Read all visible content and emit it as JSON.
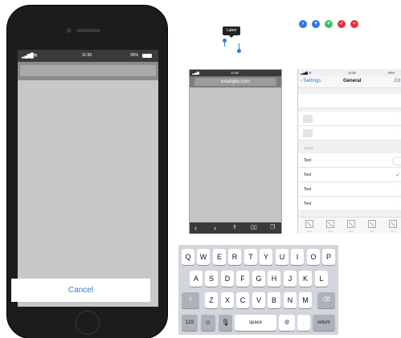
{
  "phone": {
    "status": {
      "time": "11:56",
      "battery": "95%"
    },
    "cancel_label": "Cancel"
  },
  "tooltip": {
    "label": "Label"
  },
  "icons": [
    "arrow-right-circle-icon",
    "plus-circle-icon",
    "add-circle-icon",
    "check-circle-icon",
    "minus-circle-icon"
  ],
  "browser": {
    "status": {
      "time": "11:56"
    },
    "url": "example.com",
    "toolbar": [
      "back-icon",
      "forward-icon",
      "share-icon",
      "bookmarks-icon",
      "tabs-icon"
    ]
  },
  "settings": {
    "status": {
      "time": "11:56",
      "battery": "96%"
    },
    "back_label": "Settings",
    "title": "General",
    "edit_label": "Ed",
    "section_title": "TITLE",
    "rows": [
      {
        "text": "Text",
        "accessory": "toggle"
      },
      {
        "text": "Text",
        "accessory": "check"
      },
      {
        "text": "Text",
        "accessory": "chevron"
      },
      {
        "text": "Text",
        "accessory": "chevron"
      }
    ],
    "tab_labels": [
      "Text",
      "Text",
      "Text",
      "Text",
      "Text"
    ]
  },
  "keyboard": {
    "row1": [
      "Q",
      "W",
      "E",
      "R",
      "T",
      "Y",
      "U",
      "I",
      "O",
      "P"
    ],
    "row2": [
      "A",
      "S",
      "D",
      "F",
      "G",
      "H",
      "J",
      "K",
      "L"
    ],
    "row3": [
      "Z",
      "X",
      "C",
      "V",
      "B",
      "N",
      "M"
    ],
    "numbers_label": "123",
    "space_label": "space",
    "at_label": "@",
    "dot_label": ".",
    "return_label": "return"
  },
  "colors": {
    "accent": "#2a7ae2",
    "green": "#34c759",
    "red": "#e0343a",
    "dark": "#1c1c1e"
  }
}
